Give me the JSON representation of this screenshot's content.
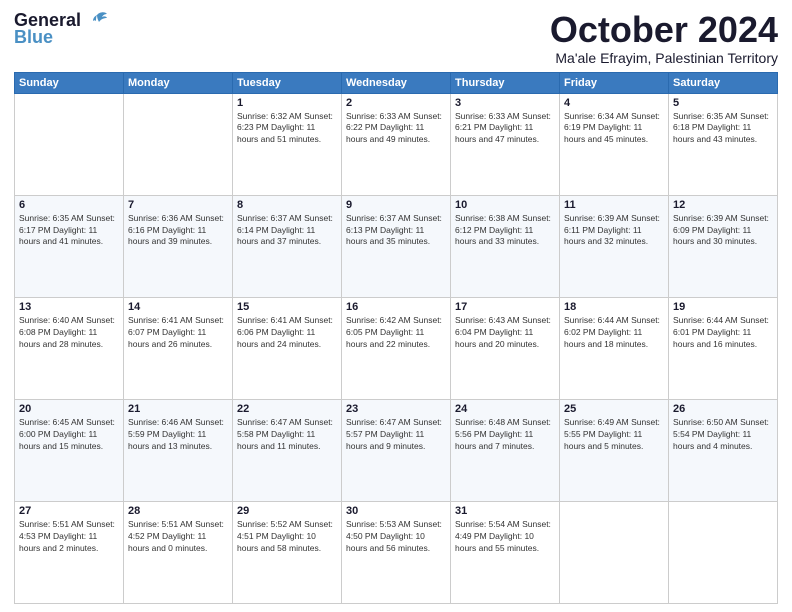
{
  "header": {
    "logo_line1": "General",
    "logo_line2": "Blue",
    "month": "October 2024",
    "location": "Ma'ale Efrayim, Palestinian Territory"
  },
  "days_of_week": [
    "Sunday",
    "Monday",
    "Tuesday",
    "Wednesday",
    "Thursday",
    "Friday",
    "Saturday"
  ],
  "weeks": [
    [
      {
        "day": "",
        "info": ""
      },
      {
        "day": "",
        "info": ""
      },
      {
        "day": "1",
        "info": "Sunrise: 6:32 AM\nSunset: 6:23 PM\nDaylight: 11 hours and 51 minutes."
      },
      {
        "day": "2",
        "info": "Sunrise: 6:33 AM\nSunset: 6:22 PM\nDaylight: 11 hours and 49 minutes."
      },
      {
        "day": "3",
        "info": "Sunrise: 6:33 AM\nSunset: 6:21 PM\nDaylight: 11 hours and 47 minutes."
      },
      {
        "day": "4",
        "info": "Sunrise: 6:34 AM\nSunset: 6:19 PM\nDaylight: 11 hours and 45 minutes."
      },
      {
        "day": "5",
        "info": "Sunrise: 6:35 AM\nSunset: 6:18 PM\nDaylight: 11 hours and 43 minutes."
      }
    ],
    [
      {
        "day": "6",
        "info": "Sunrise: 6:35 AM\nSunset: 6:17 PM\nDaylight: 11 hours and 41 minutes."
      },
      {
        "day": "7",
        "info": "Sunrise: 6:36 AM\nSunset: 6:16 PM\nDaylight: 11 hours and 39 minutes."
      },
      {
        "day": "8",
        "info": "Sunrise: 6:37 AM\nSunset: 6:14 PM\nDaylight: 11 hours and 37 minutes."
      },
      {
        "day": "9",
        "info": "Sunrise: 6:37 AM\nSunset: 6:13 PM\nDaylight: 11 hours and 35 minutes."
      },
      {
        "day": "10",
        "info": "Sunrise: 6:38 AM\nSunset: 6:12 PM\nDaylight: 11 hours and 33 minutes."
      },
      {
        "day": "11",
        "info": "Sunrise: 6:39 AM\nSunset: 6:11 PM\nDaylight: 11 hours and 32 minutes."
      },
      {
        "day": "12",
        "info": "Sunrise: 6:39 AM\nSunset: 6:09 PM\nDaylight: 11 hours and 30 minutes."
      }
    ],
    [
      {
        "day": "13",
        "info": "Sunrise: 6:40 AM\nSunset: 6:08 PM\nDaylight: 11 hours and 28 minutes."
      },
      {
        "day": "14",
        "info": "Sunrise: 6:41 AM\nSunset: 6:07 PM\nDaylight: 11 hours and 26 minutes."
      },
      {
        "day": "15",
        "info": "Sunrise: 6:41 AM\nSunset: 6:06 PM\nDaylight: 11 hours and 24 minutes."
      },
      {
        "day": "16",
        "info": "Sunrise: 6:42 AM\nSunset: 6:05 PM\nDaylight: 11 hours and 22 minutes."
      },
      {
        "day": "17",
        "info": "Sunrise: 6:43 AM\nSunset: 6:04 PM\nDaylight: 11 hours and 20 minutes."
      },
      {
        "day": "18",
        "info": "Sunrise: 6:44 AM\nSunset: 6:02 PM\nDaylight: 11 hours and 18 minutes."
      },
      {
        "day": "19",
        "info": "Sunrise: 6:44 AM\nSunset: 6:01 PM\nDaylight: 11 hours and 16 minutes."
      }
    ],
    [
      {
        "day": "20",
        "info": "Sunrise: 6:45 AM\nSunset: 6:00 PM\nDaylight: 11 hours and 15 minutes."
      },
      {
        "day": "21",
        "info": "Sunrise: 6:46 AM\nSunset: 5:59 PM\nDaylight: 11 hours and 13 minutes."
      },
      {
        "day": "22",
        "info": "Sunrise: 6:47 AM\nSunset: 5:58 PM\nDaylight: 11 hours and 11 minutes."
      },
      {
        "day": "23",
        "info": "Sunrise: 6:47 AM\nSunset: 5:57 PM\nDaylight: 11 hours and 9 minutes."
      },
      {
        "day": "24",
        "info": "Sunrise: 6:48 AM\nSunset: 5:56 PM\nDaylight: 11 hours and 7 minutes."
      },
      {
        "day": "25",
        "info": "Sunrise: 6:49 AM\nSunset: 5:55 PM\nDaylight: 11 hours and 5 minutes."
      },
      {
        "day": "26",
        "info": "Sunrise: 6:50 AM\nSunset: 5:54 PM\nDaylight: 11 hours and 4 minutes."
      }
    ],
    [
      {
        "day": "27",
        "info": "Sunrise: 5:51 AM\nSunset: 4:53 PM\nDaylight: 11 hours and 2 minutes."
      },
      {
        "day": "28",
        "info": "Sunrise: 5:51 AM\nSunset: 4:52 PM\nDaylight: 11 hours and 0 minutes."
      },
      {
        "day": "29",
        "info": "Sunrise: 5:52 AM\nSunset: 4:51 PM\nDaylight: 10 hours and 58 minutes."
      },
      {
        "day": "30",
        "info": "Sunrise: 5:53 AM\nSunset: 4:50 PM\nDaylight: 10 hours and 56 minutes."
      },
      {
        "day": "31",
        "info": "Sunrise: 5:54 AM\nSunset: 4:49 PM\nDaylight: 10 hours and 55 minutes."
      },
      {
        "day": "",
        "info": ""
      },
      {
        "day": "",
        "info": ""
      }
    ]
  ]
}
